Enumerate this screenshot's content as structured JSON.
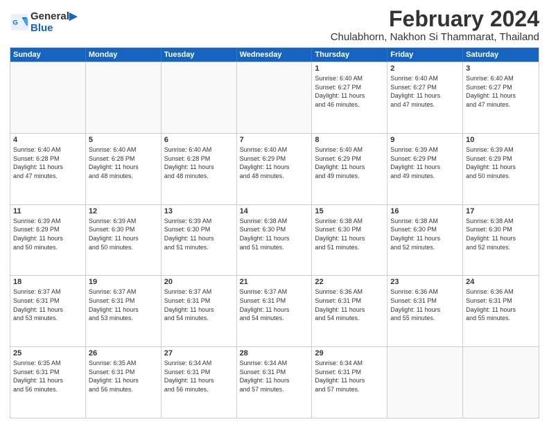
{
  "logo": {
    "line1": "General",
    "line2": "Blue"
  },
  "title": "February 2024",
  "location": "Chulabhorn, Nakhon Si Thammarat, Thailand",
  "headers": [
    "Sunday",
    "Monday",
    "Tuesday",
    "Wednesday",
    "Thursday",
    "Friday",
    "Saturday"
  ],
  "rows": [
    [
      {
        "day": "",
        "info": "",
        "empty": true
      },
      {
        "day": "",
        "info": "",
        "empty": true
      },
      {
        "day": "",
        "info": "",
        "empty": true
      },
      {
        "day": "",
        "info": "",
        "empty": true
      },
      {
        "day": "1",
        "info": "Sunrise: 6:40 AM\nSunset: 6:27 PM\nDaylight: 11 hours\nand 46 minutes."
      },
      {
        "day": "2",
        "info": "Sunrise: 6:40 AM\nSunset: 6:27 PM\nDaylight: 11 hours\nand 47 minutes."
      },
      {
        "day": "3",
        "info": "Sunrise: 6:40 AM\nSunset: 6:27 PM\nDaylight: 11 hours\nand 47 minutes."
      }
    ],
    [
      {
        "day": "4",
        "info": "Sunrise: 6:40 AM\nSunset: 6:28 PM\nDaylight: 11 hours\nand 47 minutes."
      },
      {
        "day": "5",
        "info": "Sunrise: 6:40 AM\nSunset: 6:28 PM\nDaylight: 11 hours\nand 48 minutes."
      },
      {
        "day": "6",
        "info": "Sunrise: 6:40 AM\nSunset: 6:28 PM\nDaylight: 11 hours\nand 48 minutes."
      },
      {
        "day": "7",
        "info": "Sunrise: 6:40 AM\nSunset: 6:29 PM\nDaylight: 11 hours\nand 48 minutes."
      },
      {
        "day": "8",
        "info": "Sunrise: 6:40 AM\nSunset: 6:29 PM\nDaylight: 11 hours\nand 49 minutes."
      },
      {
        "day": "9",
        "info": "Sunrise: 6:39 AM\nSunset: 6:29 PM\nDaylight: 11 hours\nand 49 minutes."
      },
      {
        "day": "10",
        "info": "Sunrise: 6:39 AM\nSunset: 6:29 PM\nDaylight: 11 hours\nand 50 minutes."
      }
    ],
    [
      {
        "day": "11",
        "info": "Sunrise: 6:39 AM\nSunset: 6:29 PM\nDaylight: 11 hours\nand 50 minutes."
      },
      {
        "day": "12",
        "info": "Sunrise: 6:39 AM\nSunset: 6:30 PM\nDaylight: 11 hours\nand 50 minutes."
      },
      {
        "day": "13",
        "info": "Sunrise: 6:39 AM\nSunset: 6:30 PM\nDaylight: 11 hours\nand 51 minutes."
      },
      {
        "day": "14",
        "info": "Sunrise: 6:38 AM\nSunset: 6:30 PM\nDaylight: 11 hours\nand 51 minutes."
      },
      {
        "day": "15",
        "info": "Sunrise: 6:38 AM\nSunset: 6:30 PM\nDaylight: 11 hours\nand 51 minutes."
      },
      {
        "day": "16",
        "info": "Sunrise: 6:38 AM\nSunset: 6:30 PM\nDaylight: 11 hours\nand 52 minutes."
      },
      {
        "day": "17",
        "info": "Sunrise: 6:38 AM\nSunset: 6:30 PM\nDaylight: 11 hours\nand 52 minutes."
      }
    ],
    [
      {
        "day": "18",
        "info": "Sunrise: 6:37 AM\nSunset: 6:31 PM\nDaylight: 11 hours\nand 53 minutes."
      },
      {
        "day": "19",
        "info": "Sunrise: 6:37 AM\nSunset: 6:31 PM\nDaylight: 11 hours\nand 53 minutes."
      },
      {
        "day": "20",
        "info": "Sunrise: 6:37 AM\nSunset: 6:31 PM\nDaylight: 11 hours\nand 54 minutes."
      },
      {
        "day": "21",
        "info": "Sunrise: 6:37 AM\nSunset: 6:31 PM\nDaylight: 11 hours\nand 54 minutes."
      },
      {
        "day": "22",
        "info": "Sunrise: 6:36 AM\nSunset: 6:31 PM\nDaylight: 11 hours\nand 54 minutes."
      },
      {
        "day": "23",
        "info": "Sunrise: 6:36 AM\nSunset: 6:31 PM\nDaylight: 11 hours\nand 55 minutes."
      },
      {
        "day": "24",
        "info": "Sunrise: 6:36 AM\nSunset: 6:31 PM\nDaylight: 11 hours\nand 55 minutes."
      }
    ],
    [
      {
        "day": "25",
        "info": "Sunrise: 6:35 AM\nSunset: 6:31 PM\nDaylight: 11 hours\nand 56 minutes."
      },
      {
        "day": "26",
        "info": "Sunrise: 6:35 AM\nSunset: 6:31 PM\nDaylight: 11 hours\nand 56 minutes."
      },
      {
        "day": "27",
        "info": "Sunrise: 6:34 AM\nSunset: 6:31 PM\nDaylight: 11 hours\nand 56 minutes."
      },
      {
        "day": "28",
        "info": "Sunrise: 6:34 AM\nSunset: 6:31 PM\nDaylight: 11 hours\nand 57 minutes."
      },
      {
        "day": "29",
        "info": "Sunrise: 6:34 AM\nSunset: 6:31 PM\nDaylight: 11 hours\nand 57 minutes."
      },
      {
        "day": "",
        "info": "",
        "empty": true
      },
      {
        "day": "",
        "info": "",
        "empty": true
      }
    ]
  ]
}
